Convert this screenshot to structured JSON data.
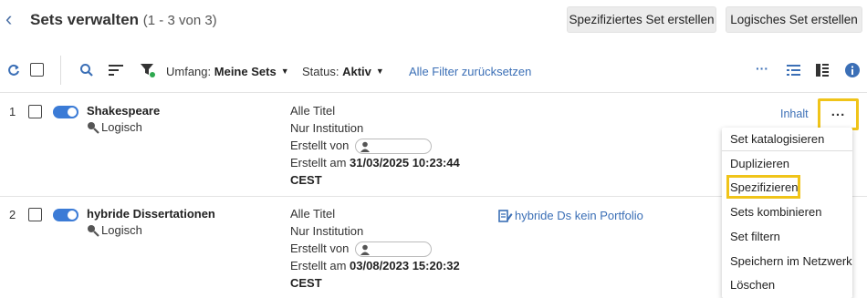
{
  "header": {
    "title": "Sets verwalten",
    "count": "(1 - 3 von 3)",
    "btn_specified": "Spezifiziertes Set erstellen",
    "btn_logical": "Logisches Set erstellen"
  },
  "toolbar": {
    "scope_label": "Umfang:",
    "scope_value": "Meine Sets",
    "status_label": "Status:",
    "status_value": "Aktiv",
    "reset_filters": "Alle Filter zurücksetzen"
  },
  "rows": [
    {
      "num": "1",
      "name": "Shakespeare",
      "type": "Logisch",
      "content": "Alle Titel",
      "scope": "Nur Institution",
      "created_by_label": "Erstellt von",
      "created_at_label": "Erstellt am",
      "created_at": "31/03/2025 10:23:44",
      "tz": "CEST",
      "action": "Inhalt"
    },
    {
      "num": "2",
      "name": "hybride Dissertationen",
      "type": "Logisch",
      "content": "Alle Titel",
      "scope": "Nur Institution",
      "created_by_label": "Erstellt von",
      "created_at_label": "Erstellt am",
      "created_at": "03/08/2023 15:20:32",
      "tz": "CEST",
      "linked": "hybride Ds kein Portfolio"
    }
  ],
  "menu": {
    "items": [
      "Set katalogisieren",
      "Duplizieren",
      "Spezifizieren",
      "Sets kombinieren",
      "Set filtern",
      "Speichern im Netzwerk",
      "Löschen"
    ],
    "highlighted": "Spezifizieren"
  },
  "colors": {
    "accent": "#3b6fb6",
    "toggle": "#3b7bd6",
    "highlight": "#f0c419",
    "filter_dot": "#2ea84f"
  }
}
